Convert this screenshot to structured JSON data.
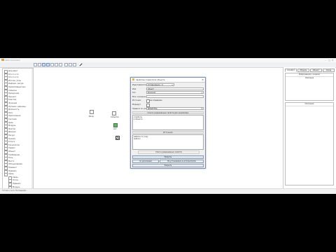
{
  "window": {
    "title": "ARIS Simulator"
  },
  "toolbar": {
    "tool_count": 9
  },
  "tree": {
    "items": [
      {
        "label": "Документ"
      },
      {
        "label": "Кто-то кто"
      },
      {
        "label": "Кто-то кто"
      },
      {
        "label": "Исполн. роль"
      },
      {
        "label": "Информ. ресурс"
      },
      {
        "label": "Нормативный док"
      },
      {
        "label": "Событие"
      },
      {
        "label": "Продукция"
      },
      {
        "label": "Процесс"
      },
      {
        "label": "Кластер"
      },
      {
        "label": "Функция"
      },
      {
        "label": "Организ. единица"
      },
      {
        "label": "Должность"
      },
      {
        "label": "Риск"
      },
      {
        "label": "Приложение"
      },
      {
        "label": "Система"
      },
      {
        "label": "Цель"
      },
      {
        "label": "Модуль"
      },
      {
        "label": "Фактор"
      },
      {
        "label": "Данные"
      },
      {
        "label": "Ресурс"
      },
      {
        "label": "Знание"
      },
      {
        "label": "Услуга"
      },
      {
        "label": "Технология"
      },
      {
        "label": "Сервис"
      },
      {
        "label": "Объект"
      },
      {
        "label": "Требование"
      },
      {
        "label": "Роль"
      },
      {
        "label": "Место"
      },
      {
        "label": "Оборудование"
      },
      {
        "label": "Элемент"
      },
      {
        "label": "Правило"
      },
      {
        "label": "Связь"
      }
    ],
    "subitems": [
      {
        "label": "Связь"
      },
      {
        "label": "Поток"
      },
      {
        "label": "Правило"
      },
      {
        "label": "Модуль"
      }
    ]
  },
  "canvas": {
    "nodes": [
      {
        "label": "Вход",
        "kind": "plain"
      },
      {
        "label": "Событие",
        "kind": "plain"
      },
      {
        "label": "Акт",
        "kind": "green"
      },
      {
        "label": "",
        "kind": "grid"
      }
    ]
  },
  "dialog": {
    "title": "Свойства стереотипа объекта",
    "close": "✕",
    "fields": [
      {
        "label": "Идентификатор",
        "value": "Оптимизация • 0",
        "type": "combo"
      },
      {
        "label": "Имя",
        "value": "объект",
        "type": "text"
      },
      {
        "label": "Тип",
        "value": "функция",
        "type": "combo"
      },
      {
        "label": "Мин. значение",
        "value": "",
        "type": "text"
      },
      {
        "label": "Источник",
        "value": "не определен",
        "type": "check"
      },
      {
        "label": "Маршрут",
        "value": "",
        "type": "check"
      },
      {
        "label": "Правило по умолчанию",
        "value": "SIMSETTEG",
        "type": "combo"
      }
    ],
    "section1": "Список разрешённых свойств для экземпляра",
    "section1_lines": [
      "атрибуты",
      "в объекте"
    ],
    "section2": "Источники",
    "section2_lines": [
      "Шаблон по коду",
      "шаблон"
    ],
    "sub_button": "Список разрешённых свойств",
    "buttons": {
      "apply": "Принять",
      "default": "по умолчанию",
      "no_items": "Не установлено в исполнителях",
      "cancel": "Закрыть"
    }
  },
  "rpanel": {
    "tabs": [
      "Атрибут",
      "Модель",
      "Объект",
      "Связь"
    ],
    "box1_header": "Информация о модели",
    "box1_sub": "Описание",
    "box2_header": "Описание"
  },
  "status": {
    "text": "Готово к исп. Последняя..."
  }
}
